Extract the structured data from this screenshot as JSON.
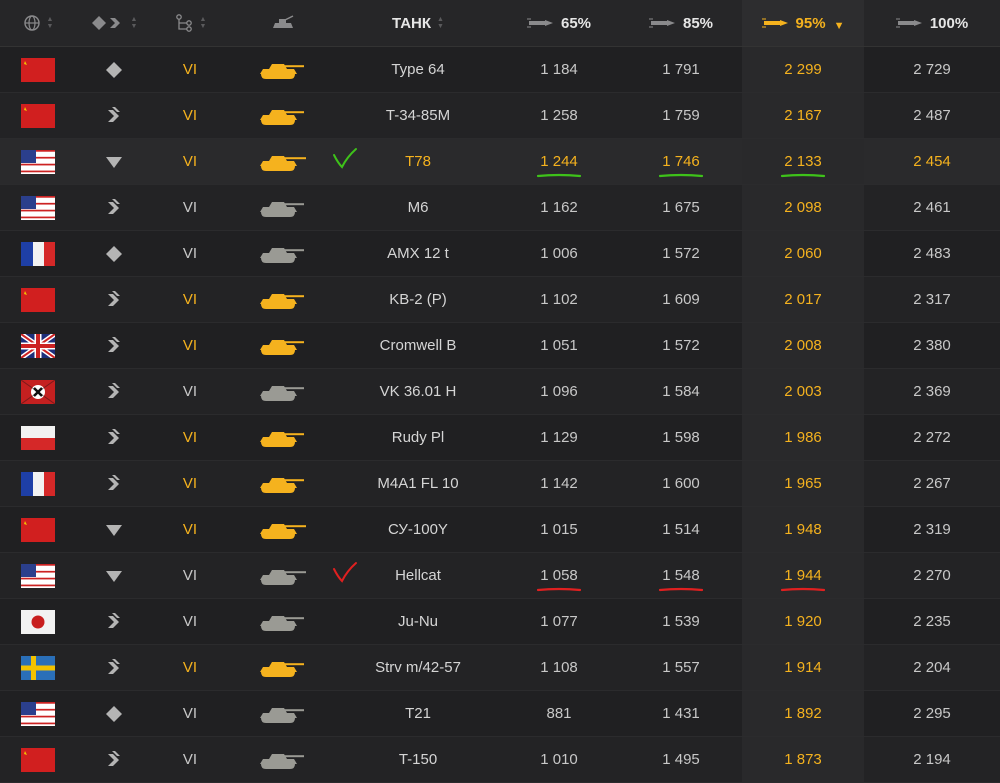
{
  "header": {
    "nation_icon": "globe-icon",
    "type_icon": "vehicle-class-icon",
    "tier_icon": "tech-tree-icon",
    "vehicle_icon": "tank-silhouette-icon",
    "tank": "ТАНК",
    "m65": "65%",
    "m85": "85%",
    "m95": "95%",
    "m100": "100%",
    "shell_icon": "shell-icon"
  },
  "colors": {
    "premium": "#f5b21e",
    "good_mark": "#3ec21a",
    "bad_mark": "#e02020",
    "regular": "#c8c8c8"
  },
  "rows": [
    {
      "nation": "ussr",
      "type": "heavy",
      "tier": "VI",
      "premium": true,
      "name": "Type 64",
      "m65": "1 184",
      "m85": "1 791",
      "m95": "2 299",
      "m100": "2 729"
    },
    {
      "nation": "ussr",
      "type": "medium",
      "tier": "VI",
      "premium": true,
      "name": "T-34-85M",
      "m65": "1 258",
      "m85": "1 759",
      "m95": "2 167",
      "m100": "2 487"
    },
    {
      "nation": "usa",
      "type": "td",
      "tier": "VI",
      "premium": true,
      "name": "T78",
      "m65": "1 244",
      "m85": "1 746",
      "m95": "2 133",
      "m100": "2 454",
      "marked": "good",
      "highlight": true
    },
    {
      "nation": "usa",
      "type": "medium",
      "tier": "VI",
      "premium": false,
      "name": "M6",
      "m65": "1 162",
      "m85": "1 675",
      "m95": "2 098",
      "m100": "2 461"
    },
    {
      "nation": "france",
      "type": "heavy",
      "tier": "VI",
      "premium": false,
      "name": "AMX 12 t",
      "m65": "1 006",
      "m85": "1 572",
      "m95": "2 060",
      "m100": "2 483"
    },
    {
      "nation": "ussr",
      "type": "medium",
      "tier": "VI",
      "premium": true,
      "name": "KB-2 (P)",
      "m65": "1 102",
      "m85": "1 609",
      "m95": "2 017",
      "m100": "2 317"
    },
    {
      "nation": "uk",
      "type": "medium",
      "tier": "VI",
      "premium": true,
      "name": "Cromwell B",
      "m65": "1 051",
      "m85": "1 572",
      "m95": "2 008",
      "m100": "2 380"
    },
    {
      "nation": "germany",
      "type": "medium",
      "tier": "VI",
      "premium": false,
      "name": "VK 36.01 H",
      "m65": "1 096",
      "m85": "1 584",
      "m95": "2 003",
      "m100": "2 369"
    },
    {
      "nation": "poland",
      "type": "medium",
      "tier": "VI",
      "premium": true,
      "name": "Rudy Pl",
      "m65": "1 129",
      "m85": "1 598",
      "m95": "1 986",
      "m100": "2 272"
    },
    {
      "nation": "france",
      "type": "medium",
      "tier": "VI",
      "premium": true,
      "name": "M4A1 FL 10",
      "m65": "1 142",
      "m85": "1 600",
      "m95": "1 965",
      "m100": "2 267"
    },
    {
      "nation": "ussr",
      "type": "td",
      "tier": "VI",
      "premium": true,
      "name": "СУ-100Y",
      "m65": "1 015",
      "m85": "1 514",
      "m95": "1 948",
      "m100": "2 319"
    },
    {
      "nation": "usa",
      "type": "td",
      "tier": "VI",
      "premium": false,
      "name": "Hellcat",
      "m65": "1 058",
      "m85": "1 548",
      "m95": "1 944",
      "m100": "2 270",
      "marked": "bad"
    },
    {
      "nation": "japan",
      "type": "medium",
      "tier": "VI",
      "premium": false,
      "name": "Ju-Nu",
      "m65": "1 077",
      "m85": "1 539",
      "m95": "1 920",
      "m100": "2 235"
    },
    {
      "nation": "sweden",
      "type": "medium",
      "tier": "VI",
      "premium": true,
      "name": "Strv m/42-57",
      "m65": "1 108",
      "m85": "1 557",
      "m95": "1 914",
      "m100": "2 204"
    },
    {
      "nation": "usa",
      "type": "heavy",
      "tier": "VI",
      "premium": false,
      "name": "T21",
      "m65": "881",
      "m85": "1 431",
      "m95": "1 892",
      "m100": "2 295"
    },
    {
      "nation": "ussr",
      "type": "medium",
      "tier": "VI",
      "premium": false,
      "name": "T-150",
      "m65": "1 010",
      "m85": "1 495",
      "m95": "1 873",
      "m100": "2 194"
    }
  ]
}
